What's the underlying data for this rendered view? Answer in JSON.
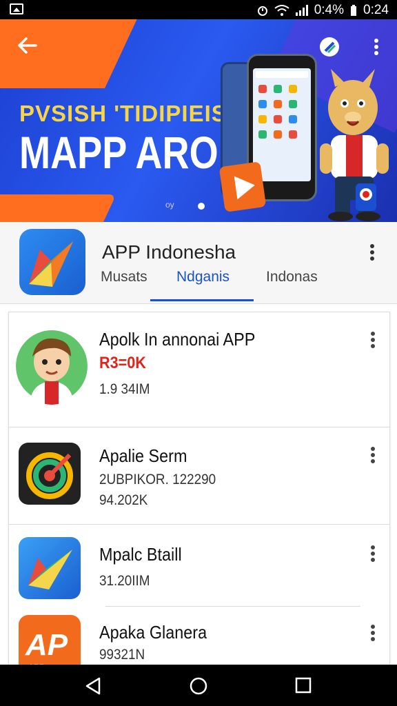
{
  "status_bar": {
    "battery_text": "0:4%",
    "time": "0:24"
  },
  "hero": {
    "line1": "PVSISH 'TIDIPIEIS",
    "line2": "MAPP ARONIA",
    "corner_text": "oy"
  },
  "app": {
    "title": "APP Indonesha",
    "tabs": [
      "Musats",
      "Ndganis",
      "Indonas"
    ],
    "active_tab": "Ndganis"
  },
  "list": {
    "items": [
      {
        "name": "Apolk In annonai APP",
        "line1": "R3=0K",
        "line2": "1.9 34IM",
        "icon": "mascot-avatar-icon"
      },
      {
        "name": "Apalie Serm",
        "line1": "2UBPIKOR. 122290",
        "line2": "94.202K",
        "icon": "target-app-icon"
      },
      {
        "name": "Mpalc Btaill",
        "line1": "31.20IIM",
        "line2": "",
        "icon": "paper-plane-app-icon"
      },
      {
        "name": "Apaka Glanera",
        "line1": "99321N",
        "line2": "",
        "icon": "ap-app-icon",
        "icon_text": "AP",
        "icon_subtext": "APP"
      }
    ]
  },
  "colors": {
    "accent": "#1a4fd0",
    "price_red": "#e2231a",
    "hero_orange": "#ff6d1f",
    "hero_blue": "#2a5af0"
  }
}
